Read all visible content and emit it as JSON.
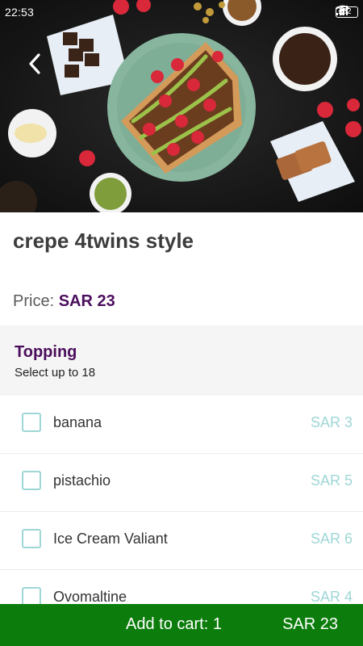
{
  "status_bar": {
    "time": "22:53",
    "battery": "62"
  },
  "hero": {
    "icon": "back-arrow-icon"
  },
  "product": {
    "title": "crepe 4twins style",
    "price_label": "Price:",
    "price_value": "SAR 23"
  },
  "topping": {
    "title": "Topping",
    "subtitle": "Select up to 18",
    "options": [
      {
        "name": "banana",
        "price": "SAR 3"
      },
      {
        "name": "pistachio",
        "price": "SAR 5"
      },
      {
        "name": "Ice Cream Valiant",
        "price": "SAR 6"
      },
      {
        "name": "Ovomaltine",
        "price": "SAR 4"
      }
    ]
  },
  "cart": {
    "label": "Add to cart: 1",
    "total": "SAR 23"
  },
  "colors": {
    "accent_purple": "#4c0e5c",
    "checkbox_teal": "#9fd6d6",
    "cart_green": "#0c7d0c"
  }
}
